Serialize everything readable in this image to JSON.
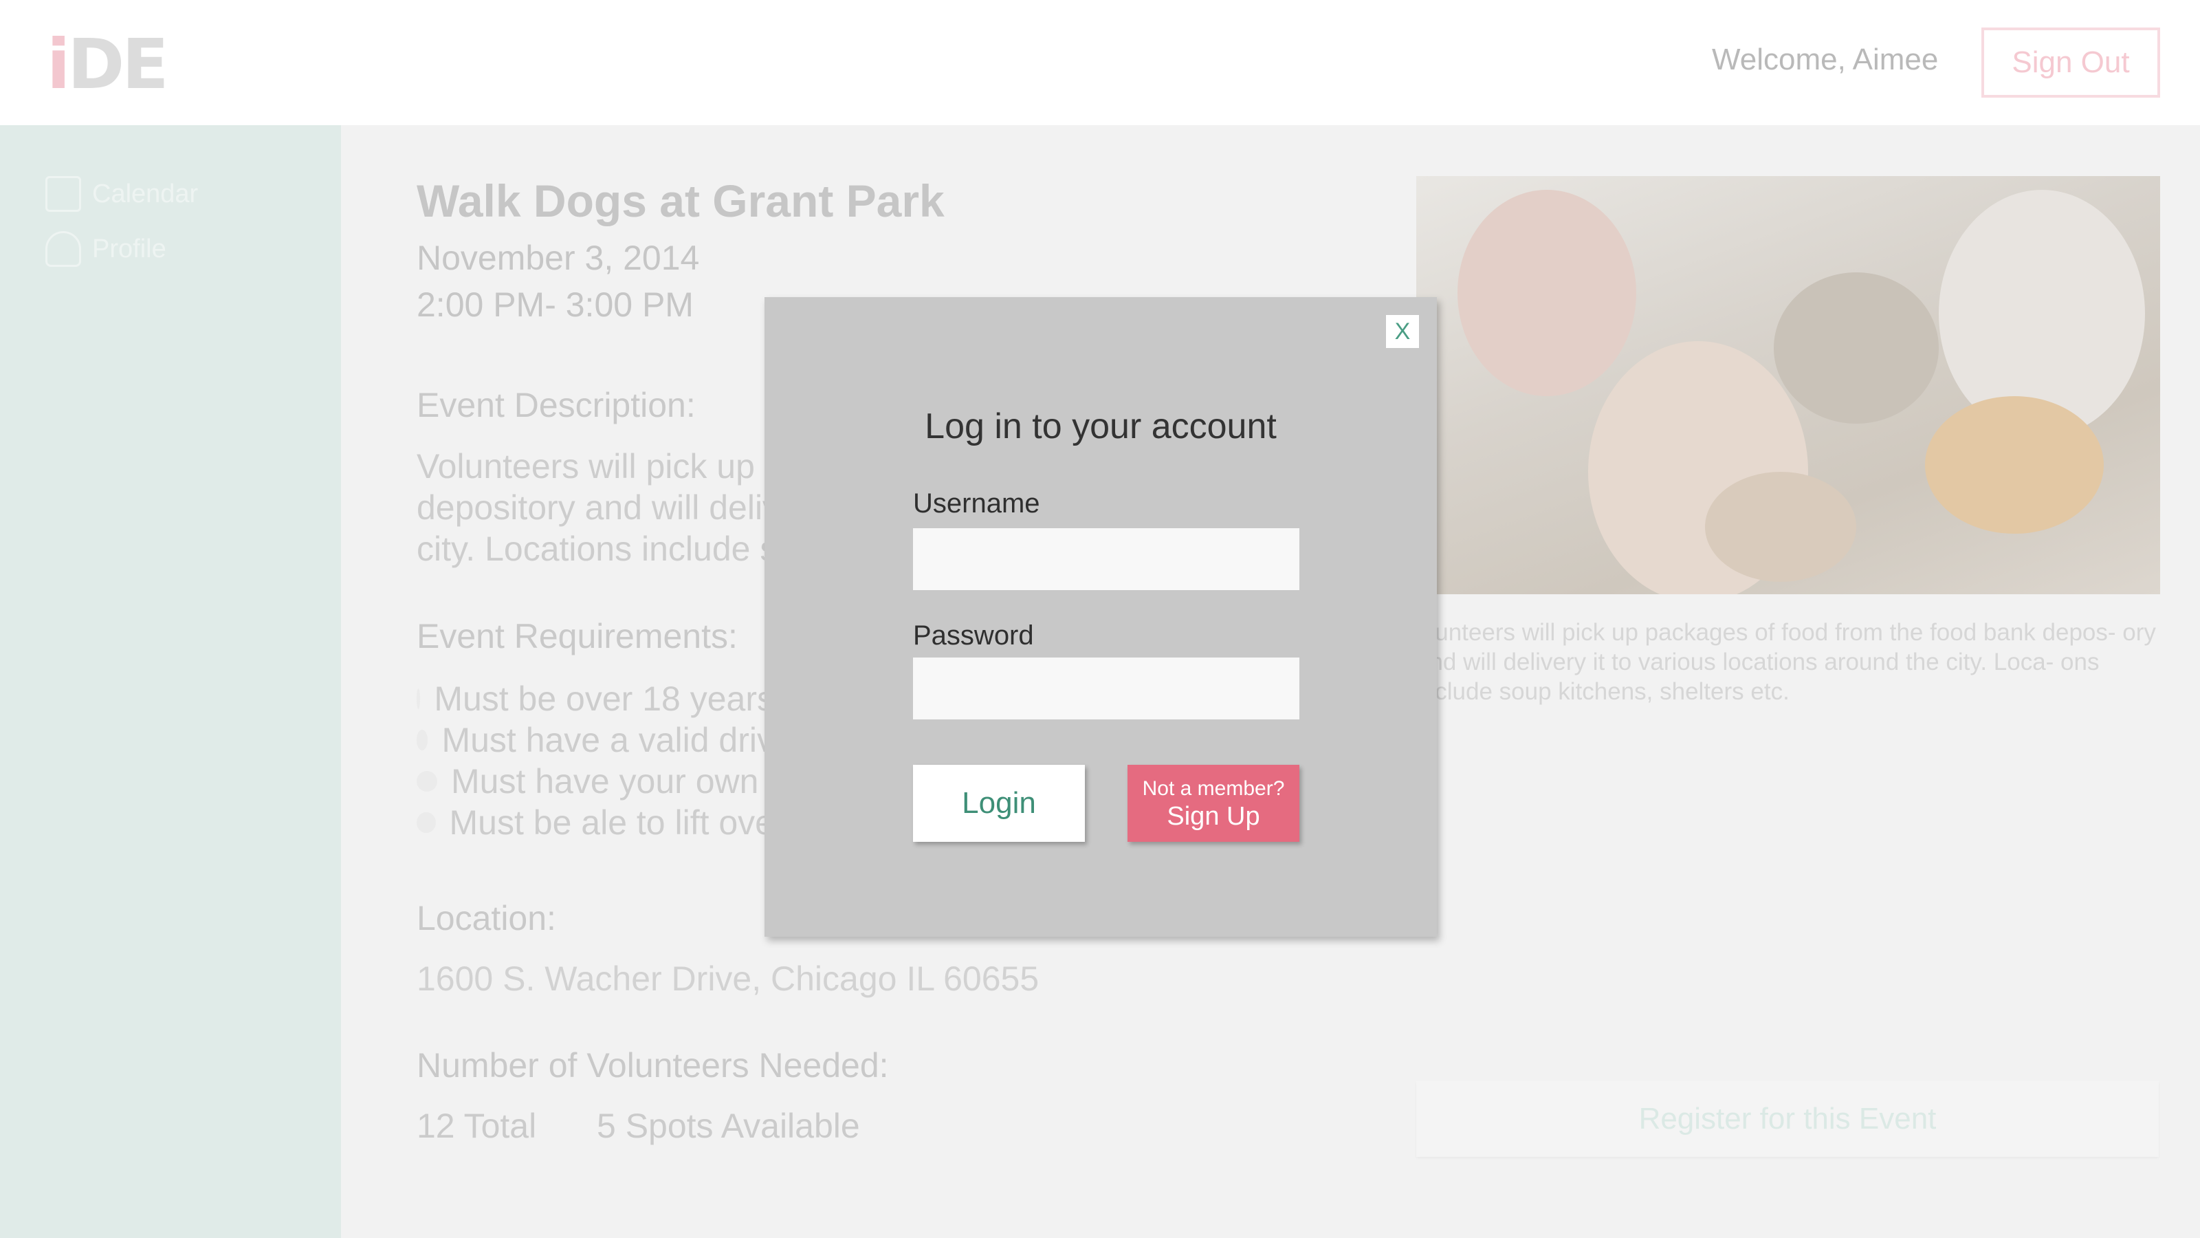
{
  "header": {
    "logo_i": "i",
    "logo_rest": "DE",
    "welcome": "Welcome, Aimee",
    "signout_label": "Sign Out"
  },
  "sidebar": {
    "items": [
      {
        "label": "Calendar",
        "icon": "calendar-icon"
      },
      {
        "label": "Profile",
        "icon": "person-icon"
      }
    ]
  },
  "event": {
    "title": "Walk Dogs at Grant Park",
    "date": "November 3, 2014",
    "time": "2:00 PM- 3:00 PM",
    "description_heading": "Event Description:",
    "description_lines": [
      "Volunteers will pick up p",
      "depository and will deliv",
      "city. Locations include s"
    ],
    "requirements_heading": "Event Requirements:",
    "requirements": [
      "Must be over 18 years",
      "Must have a valid driv",
      "Must have your own",
      "Must be ale to lift ove"
    ],
    "location_heading": "Location:",
    "location": "1600 S. Wacher Drive, Chicago IL 60655",
    "volunteers_heading": "Number of Volunteers Needed:",
    "volunteers_total": "12 Total",
    "volunteers_available": "5 Spots Available",
    "photo_caption": "olunteers will pick up packages of food from the food bank depos- ory and will delivery it to various locations around the city. Loca- ons include soup kitchens, shelters etc.",
    "register_label": "Register for this Event"
  },
  "modal": {
    "close_label": "X",
    "title": "Log in to your account",
    "username_label": "Username",
    "username_value": "",
    "password_label": "Password",
    "password_value": "",
    "login_label": "Login",
    "signup_prompt": "Not a member?",
    "signup_label": "Sign Up"
  },
  "colors": {
    "accent_green": "#3e8f77",
    "accent_pink": "#e56b80",
    "modal_bg": "#c8c8c8",
    "sidebar_bg": "#e0ebe8"
  }
}
